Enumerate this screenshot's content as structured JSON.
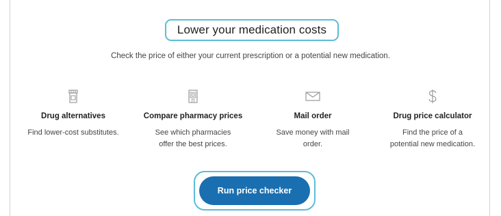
{
  "header": {
    "title": "Lower your medication costs",
    "subtitle": "Check the price of either your current prescription or a potential new medication."
  },
  "features": [
    {
      "icon": "pill-bottle-icon",
      "title": "Drug alternatives",
      "desc_lines": [
        "Find lower-cost substitutes."
      ]
    },
    {
      "icon": "pharmacy-building-icon",
      "title": "Compare pharmacy prices",
      "desc_lines": [
        "See which pharmacies",
        "offer the best prices."
      ]
    },
    {
      "icon": "envelope-icon",
      "title": "Mail order",
      "desc_lines": [
        "Save money with mail",
        "order."
      ]
    },
    {
      "icon": "dollar-sign-icon",
      "title": "Drug price calculator",
      "desc_lines": [
        "Find the price of a",
        "potential new medication."
      ]
    }
  ],
  "cta": {
    "label": "Run price checker"
  },
  "colors": {
    "primary": "#1a6fb0",
    "highlight": "#5bbcd6",
    "icon": "#9a9a9a"
  }
}
